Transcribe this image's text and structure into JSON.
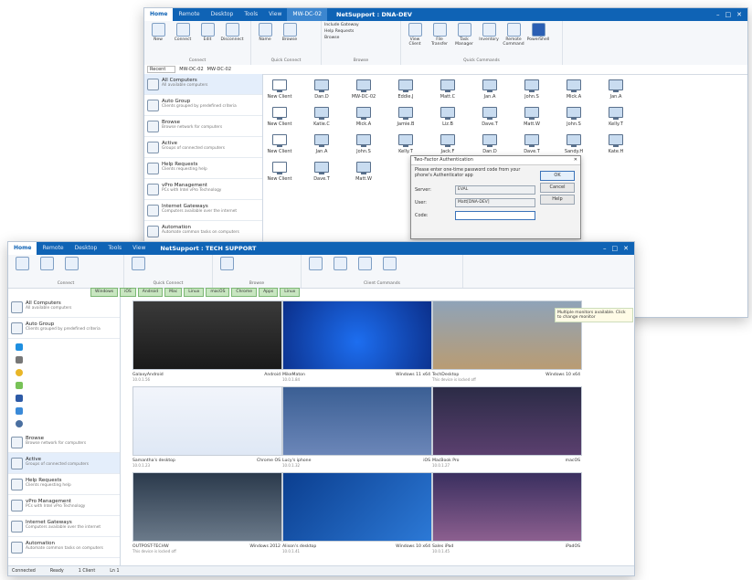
{
  "back_window": {
    "tabs": [
      "Home",
      "Remote",
      "Desktop",
      "Tools",
      "View"
    ],
    "active_tab": "Home",
    "context_tab": "MW-DC-02",
    "title": "NetSupport : DNA-DEV",
    "ribbon": {
      "groups": [
        {
          "label": "Connect",
          "buttons": [
            "New",
            "Connect",
            "Edit",
            "Disconnect"
          ]
        },
        {
          "label": "Quick Connect",
          "buttons": [
            "Name",
            "Browse"
          ]
        },
        {
          "label": "Browse",
          "buttons": [
            "Include Gateway",
            "Help Requests",
            "Browse"
          ]
        },
        {
          "label": "Quick Commands",
          "buttons": [
            "View Client",
            "File Transfer",
            "Task Manager",
            "Inventory",
            "Remote Command",
            "PowerShell"
          ]
        }
      ]
    },
    "address": [
      "Recent",
      "MW-DC-02",
      "MW-DC-02"
    ],
    "sidebar": [
      {
        "title": "All Computers",
        "sub": "All available computers"
      },
      {
        "title": "Auto Group",
        "sub": "Clients grouped by predefined criteria"
      },
      {
        "title": "Browse",
        "sub": "Browse network for computers"
      },
      {
        "title": "Active",
        "sub": "Groups of connected computers"
      },
      {
        "title": "Help Requests",
        "sub": "Clients requesting help"
      },
      {
        "title": "vPro Management",
        "sub": "PCs with Intel vPro Technology"
      },
      {
        "title": "Internet Gateways",
        "sub": "Computers available over the internet"
      },
      {
        "title": "Automation",
        "sub": "Automate common tasks on computers"
      }
    ],
    "clients": [
      [
        "New Client",
        "Dan.D",
        "MW-DC-02",
        "Eddie.J",
        "Matt.C",
        "Jan.A",
        "John.S",
        "Mick.A",
        "Jan.A"
      ],
      [
        "New Client",
        "Katie.C",
        "Mick.A",
        "Jamie.B",
        "Liz.B",
        "Dave.T",
        "Matt.W",
        "John.S",
        "Kelly.T"
      ],
      [
        "New Client",
        "Jan.A",
        "John.S",
        "Kelly.T",
        "Jack.F",
        "Dan.D",
        "Dave.T",
        "Sandy.H",
        "Kate.H"
      ],
      [
        "New Client",
        "Dave.T",
        "Matt.W"
      ]
    ]
  },
  "dialog": {
    "title": "Two-Factor Authentication",
    "message": "Please enter one-time password code from your phone's Authenticator app",
    "server_label": "Server:",
    "server_value": "EVAL",
    "user_label": "User:",
    "user_value": "Matt[DNA-DEV]",
    "code_label": "Code:",
    "code_value": "",
    "ok": "OK",
    "cancel": "Cancel",
    "help": "Help"
  },
  "front_window": {
    "tabs": [
      "Home",
      "Remote",
      "Desktop",
      "Tools",
      "View"
    ],
    "active_tab": "Home",
    "title": "NetSupport : TECH SUPPORT",
    "ribbon_groups": [
      "Connect",
      "Quick Connect",
      "Browse",
      "Client Commands"
    ],
    "group_tabs": [
      "Windows",
      "iOS",
      "Android",
      "Mac",
      "Linux",
      "macOS",
      "Chrome",
      "Apps",
      "Linux"
    ],
    "sidebar": [
      {
        "title": "All Computers",
        "sub": "All available computers"
      },
      {
        "title": "Auto Group",
        "sub": "Clients grouped by predefined criteria"
      },
      {
        "title": "Browse",
        "sub": "Browse network for computers"
      },
      {
        "title": "Active",
        "sub": "Groups of connected computers"
      },
      {
        "title": "Help Requests",
        "sub": "Clients requesting help"
      },
      {
        "title": "vPro Management",
        "sub": "PCs with Intel vPro Technology"
      },
      {
        "title": "Internet Gateways",
        "sub": "Computers available over the internet"
      },
      {
        "title": "Automation",
        "sub": "Automate common tasks on computers"
      }
    ],
    "thumbnails": [
      {
        "name": "GalaxyAndroid",
        "os": "Android",
        "sub": "10.0.1.56"
      },
      {
        "name": "MikeMaton",
        "os": "Windows 11 x64",
        "sub": "10.0.1.84"
      },
      {
        "name": "TechDesktop",
        "os": "Windows 10 x64",
        "sub": "This device is locked off"
      },
      {
        "name": "Samantha's desktop",
        "os": "Chrome OS",
        "sub": "10.0.1.23"
      },
      {
        "name": "Lucy's iphone",
        "os": "iOS",
        "sub": "10.0.1.32"
      },
      {
        "name": "MacBook Pro",
        "os": "macOS",
        "sub": "10.0.1.27"
      },
      {
        "name": "OUTPOST-TECHW",
        "os": "Windows 2012",
        "sub": "This device is locked off"
      },
      {
        "name": "Alison's desktop",
        "os": "Windows 10 x64",
        "sub": "10.0.1.41"
      },
      {
        "name": "Sales iPad",
        "os": "iPadOS",
        "sub": "10.0.1.45"
      }
    ],
    "tooltip": "Multiple monitors available. Click to change monitor",
    "status": [
      "Connected",
      "Ready",
      "1 Client",
      "Ln 1"
    ]
  },
  "colors": {
    "titlebar": "#0f63b5",
    "accent": "#2d7bd3",
    "green_tab": "#c8e6c0"
  }
}
